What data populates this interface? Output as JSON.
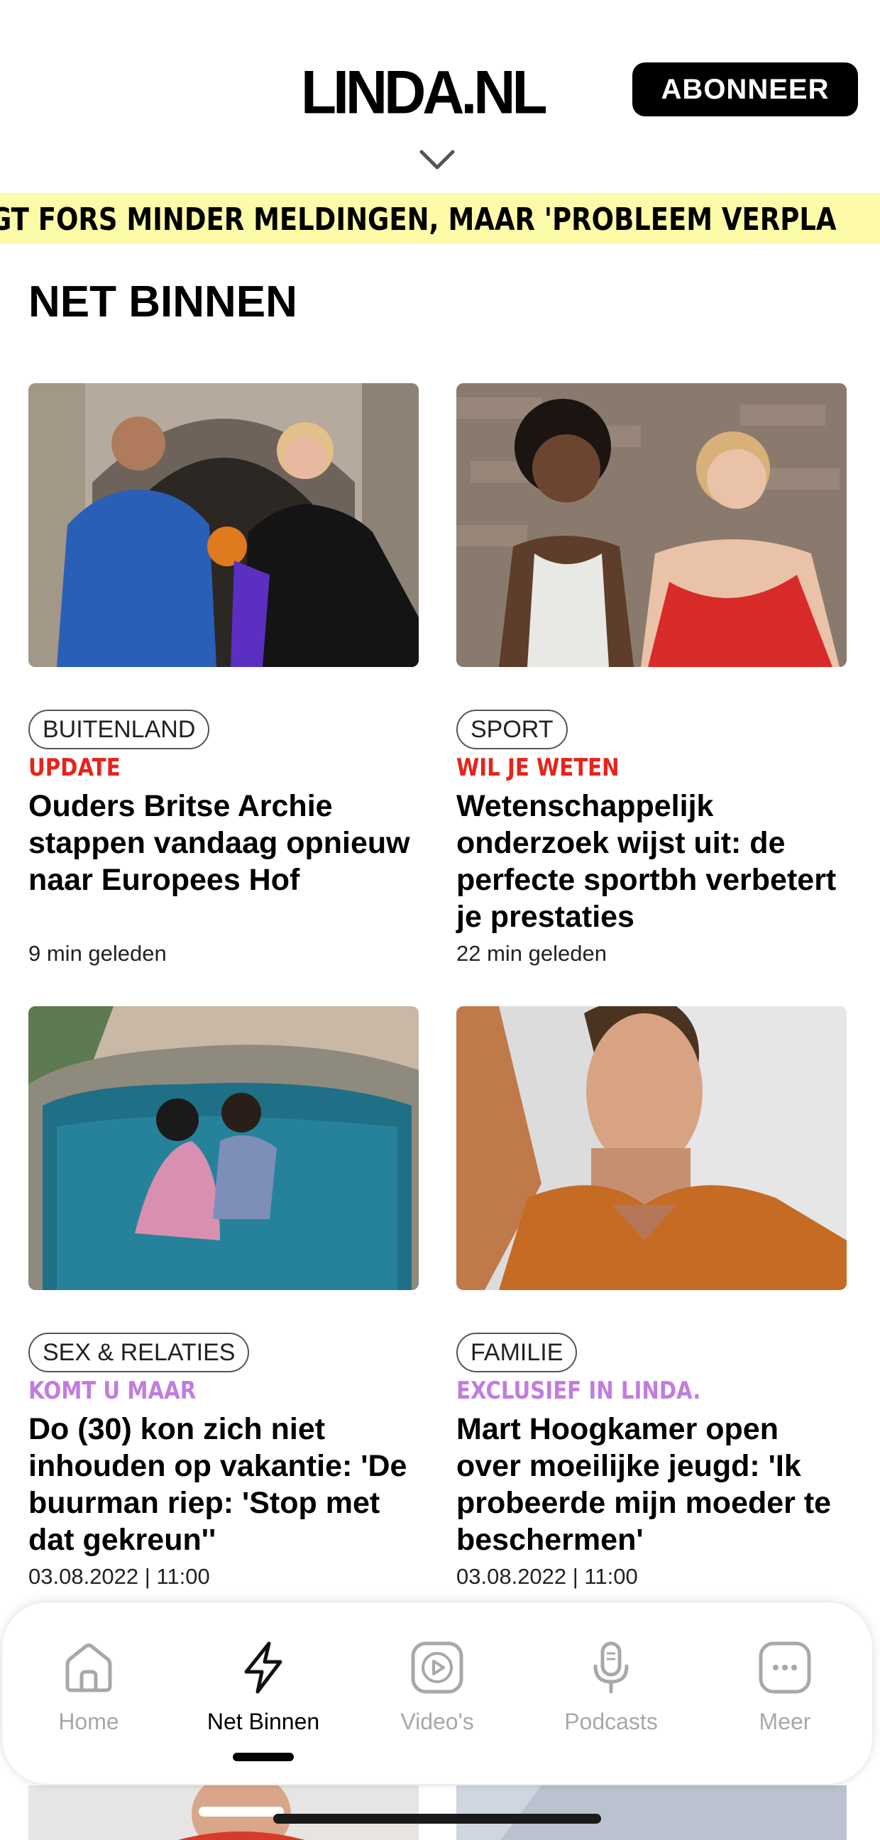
{
  "header": {
    "logo": "LINDA.NL",
    "subscribe_label": "ABONNEER"
  },
  "ticker": {
    "text": "GT FORS MINDER MELDINGEN, MAAR 'PROBLEEM VERPLA"
  },
  "section": {
    "title": "NET BINNEN"
  },
  "articles": [
    {
      "category": "BUITENLAND",
      "kicker": "UPDATE",
      "kicker_color": "#e8231b",
      "headline": "Ouders Britse Archie stappen vandaag opnieuw naar Europees Hof",
      "time": "9 min geleden"
    },
    {
      "category": "SPORT",
      "kicker": "WIL JE WETEN",
      "kicker_color": "#e8231b",
      "headline": "Wetenschappelijk onderzoek wijst uit: de perfecte sportbh verbetert je prestaties",
      "time": "22 min geleden"
    },
    {
      "category": "SEX & RELATIES",
      "kicker": "KOMT U MAAR",
      "kicker_color": "#c27ce0",
      "headline": "Do (30) kon zich niet inhouden op vakantie: 'De buurman riep: 'Stop met dat gekreun''",
      "time": "03.08.2022 | 11:00"
    },
    {
      "category": "FAMILIE",
      "kicker": "EXCLUSIEF IN LINDA.",
      "kicker_color": "#c27ce0",
      "headline": "Mart Hoogkamer open over moeilijke jeugd: 'Ik probeerde mijn moeder te beschermen'",
      "time": "03.08.2022 | 11:00"
    }
  ],
  "tabbar": {
    "items": [
      {
        "label": "Home",
        "icon": "home-icon",
        "active": false
      },
      {
        "label": "Net Binnen",
        "icon": "bolt-icon",
        "active": true
      },
      {
        "label": "Video's",
        "icon": "play-icon",
        "active": false
      },
      {
        "label": "Podcasts",
        "icon": "microphone-icon",
        "active": false
      },
      {
        "label": "Meer",
        "icon": "more-icon",
        "active": false
      }
    ]
  },
  "colors": {
    "ticker_bg": "#fdfaa8",
    "kicker_red": "#e8231b",
    "kicker_purple": "#c27ce0",
    "tab_inactive": "#a8a8a8"
  }
}
